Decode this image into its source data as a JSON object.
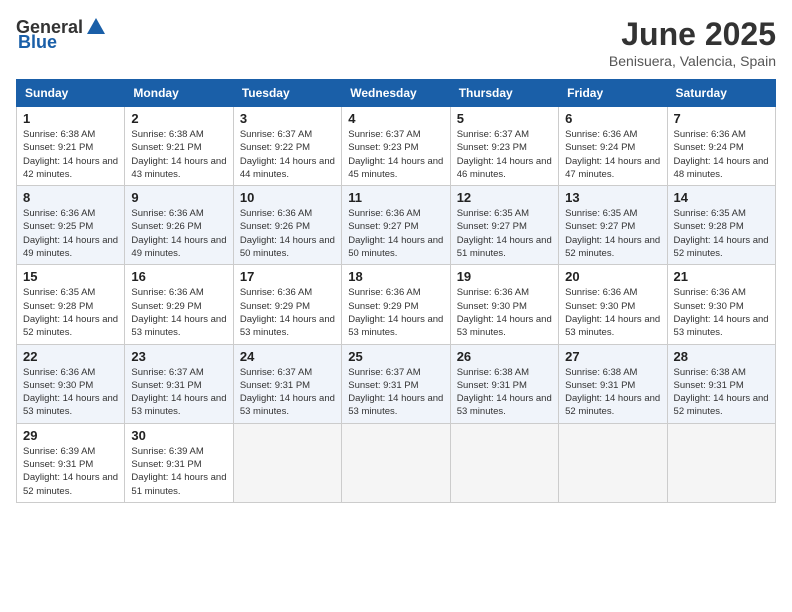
{
  "logo": {
    "general": "General",
    "blue": "Blue"
  },
  "title": {
    "month": "June 2025",
    "location": "Benisuera, Valencia, Spain"
  },
  "headers": [
    "Sunday",
    "Monday",
    "Tuesday",
    "Wednesday",
    "Thursday",
    "Friday",
    "Saturday"
  ],
  "weeks": [
    [
      {
        "day": "1",
        "sunrise": "Sunrise: 6:38 AM",
        "sunset": "Sunset: 9:21 PM",
        "daylight": "Daylight: 14 hours and 42 minutes."
      },
      {
        "day": "2",
        "sunrise": "Sunrise: 6:38 AM",
        "sunset": "Sunset: 9:21 PM",
        "daylight": "Daylight: 14 hours and 43 minutes."
      },
      {
        "day": "3",
        "sunrise": "Sunrise: 6:37 AM",
        "sunset": "Sunset: 9:22 PM",
        "daylight": "Daylight: 14 hours and 44 minutes."
      },
      {
        "day": "4",
        "sunrise": "Sunrise: 6:37 AM",
        "sunset": "Sunset: 9:23 PM",
        "daylight": "Daylight: 14 hours and 45 minutes."
      },
      {
        "day": "5",
        "sunrise": "Sunrise: 6:37 AM",
        "sunset": "Sunset: 9:23 PM",
        "daylight": "Daylight: 14 hours and 46 minutes."
      },
      {
        "day": "6",
        "sunrise": "Sunrise: 6:36 AM",
        "sunset": "Sunset: 9:24 PM",
        "daylight": "Daylight: 14 hours and 47 minutes."
      },
      {
        "day": "7",
        "sunrise": "Sunrise: 6:36 AM",
        "sunset": "Sunset: 9:24 PM",
        "daylight": "Daylight: 14 hours and 48 minutes."
      }
    ],
    [
      {
        "day": "8",
        "sunrise": "Sunrise: 6:36 AM",
        "sunset": "Sunset: 9:25 PM",
        "daylight": "Daylight: 14 hours and 49 minutes."
      },
      {
        "day": "9",
        "sunrise": "Sunrise: 6:36 AM",
        "sunset": "Sunset: 9:26 PM",
        "daylight": "Daylight: 14 hours and 49 minutes."
      },
      {
        "day": "10",
        "sunrise": "Sunrise: 6:36 AM",
        "sunset": "Sunset: 9:26 PM",
        "daylight": "Daylight: 14 hours and 50 minutes."
      },
      {
        "day": "11",
        "sunrise": "Sunrise: 6:36 AM",
        "sunset": "Sunset: 9:27 PM",
        "daylight": "Daylight: 14 hours and 50 minutes."
      },
      {
        "day": "12",
        "sunrise": "Sunrise: 6:35 AM",
        "sunset": "Sunset: 9:27 PM",
        "daylight": "Daylight: 14 hours and 51 minutes."
      },
      {
        "day": "13",
        "sunrise": "Sunrise: 6:35 AM",
        "sunset": "Sunset: 9:27 PM",
        "daylight": "Daylight: 14 hours and 52 minutes."
      },
      {
        "day": "14",
        "sunrise": "Sunrise: 6:35 AM",
        "sunset": "Sunset: 9:28 PM",
        "daylight": "Daylight: 14 hours and 52 minutes."
      }
    ],
    [
      {
        "day": "15",
        "sunrise": "Sunrise: 6:35 AM",
        "sunset": "Sunset: 9:28 PM",
        "daylight": "Daylight: 14 hours and 52 minutes."
      },
      {
        "day": "16",
        "sunrise": "Sunrise: 6:36 AM",
        "sunset": "Sunset: 9:29 PM",
        "daylight": "Daylight: 14 hours and 53 minutes."
      },
      {
        "day": "17",
        "sunrise": "Sunrise: 6:36 AM",
        "sunset": "Sunset: 9:29 PM",
        "daylight": "Daylight: 14 hours and 53 minutes."
      },
      {
        "day": "18",
        "sunrise": "Sunrise: 6:36 AM",
        "sunset": "Sunset: 9:29 PM",
        "daylight": "Daylight: 14 hours and 53 minutes."
      },
      {
        "day": "19",
        "sunrise": "Sunrise: 6:36 AM",
        "sunset": "Sunset: 9:30 PM",
        "daylight": "Daylight: 14 hours and 53 minutes."
      },
      {
        "day": "20",
        "sunrise": "Sunrise: 6:36 AM",
        "sunset": "Sunset: 9:30 PM",
        "daylight": "Daylight: 14 hours and 53 minutes."
      },
      {
        "day": "21",
        "sunrise": "Sunrise: 6:36 AM",
        "sunset": "Sunset: 9:30 PM",
        "daylight": "Daylight: 14 hours and 53 minutes."
      }
    ],
    [
      {
        "day": "22",
        "sunrise": "Sunrise: 6:36 AM",
        "sunset": "Sunset: 9:30 PM",
        "daylight": "Daylight: 14 hours and 53 minutes."
      },
      {
        "day": "23",
        "sunrise": "Sunrise: 6:37 AM",
        "sunset": "Sunset: 9:31 PM",
        "daylight": "Daylight: 14 hours and 53 minutes."
      },
      {
        "day": "24",
        "sunrise": "Sunrise: 6:37 AM",
        "sunset": "Sunset: 9:31 PM",
        "daylight": "Daylight: 14 hours and 53 minutes."
      },
      {
        "day": "25",
        "sunrise": "Sunrise: 6:37 AM",
        "sunset": "Sunset: 9:31 PM",
        "daylight": "Daylight: 14 hours and 53 minutes."
      },
      {
        "day": "26",
        "sunrise": "Sunrise: 6:38 AM",
        "sunset": "Sunset: 9:31 PM",
        "daylight": "Daylight: 14 hours and 53 minutes."
      },
      {
        "day": "27",
        "sunrise": "Sunrise: 6:38 AM",
        "sunset": "Sunset: 9:31 PM",
        "daylight": "Daylight: 14 hours and 52 minutes."
      },
      {
        "day": "28",
        "sunrise": "Sunrise: 6:38 AM",
        "sunset": "Sunset: 9:31 PM",
        "daylight": "Daylight: 14 hours and 52 minutes."
      }
    ],
    [
      {
        "day": "29",
        "sunrise": "Sunrise: 6:39 AM",
        "sunset": "Sunset: 9:31 PM",
        "daylight": "Daylight: 14 hours and 52 minutes."
      },
      {
        "day": "30",
        "sunrise": "Sunrise: 6:39 AM",
        "sunset": "Sunset: 9:31 PM",
        "daylight": "Daylight: 14 hours and 51 minutes."
      },
      null,
      null,
      null,
      null,
      null
    ]
  ]
}
